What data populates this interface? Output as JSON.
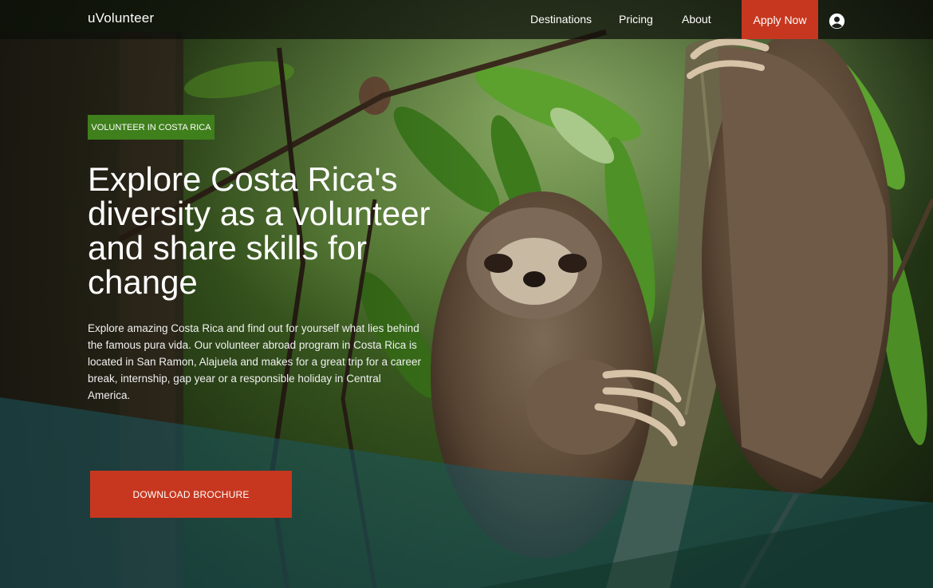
{
  "header": {
    "logo": "uVolunteer",
    "nav": [
      "Destinations",
      "Pricing",
      "About"
    ],
    "apply_label": "Apply Now"
  },
  "hero": {
    "tag": "VOLUNTEER IN COSTA RICA",
    "headline": "Explore Costa Rica's diversity as a volunteer and share skills for change",
    "description": "Explore amazing Costa Rica and find out for yourself what lies behind the famous pura vida. Our volunteer abroad program in Costa Rica is located in San Ramon, Alajuela and makes for a great trip for a career break, internship, gap year or a responsible holiday in Central America.",
    "cta_label": "DOWNLOAD BROCHURE"
  },
  "colors": {
    "accent": "#c7371f",
    "tag_green": "#3f7f1c",
    "overlay_teal": "#1b5860"
  },
  "icons": {
    "user": "user-circle-icon"
  }
}
